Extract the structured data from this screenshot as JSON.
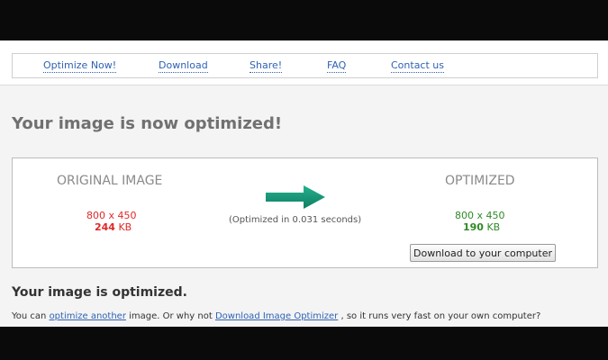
{
  "nav": {
    "items": [
      {
        "label": "Optimize Now!"
      },
      {
        "label": "Download"
      },
      {
        "label": "Share!"
      },
      {
        "label": "FAQ"
      },
      {
        "label": "Contact us"
      }
    ]
  },
  "headline": "Your image is now optimized!",
  "result": {
    "original_title": "ORIGINAL IMAGE",
    "original_dims": "800 x 450",
    "original_size_value": "244",
    "original_size_unit": "KB",
    "optimized_title": "OPTIMIZED",
    "optimized_dims": "800 x 450",
    "optimized_size_value": "190",
    "optimized_size_unit": "KB",
    "time_text": "(Optimized in 0.031 seconds)",
    "download_button": "Download to your computer",
    "arrow_icon": "right-arrow-icon",
    "colors": {
      "original": "#e02828",
      "optimized": "#2f8a26",
      "arrow": "#1a9a7c"
    }
  },
  "summary": {
    "title": "Your image is optimized.",
    "text_1": "You can ",
    "link_1": "optimize another",
    "text_2": " image. Or why not ",
    "link_2": "Download Image Optimizer",
    "text_3": " , so it runs very fast on your own computer?"
  }
}
